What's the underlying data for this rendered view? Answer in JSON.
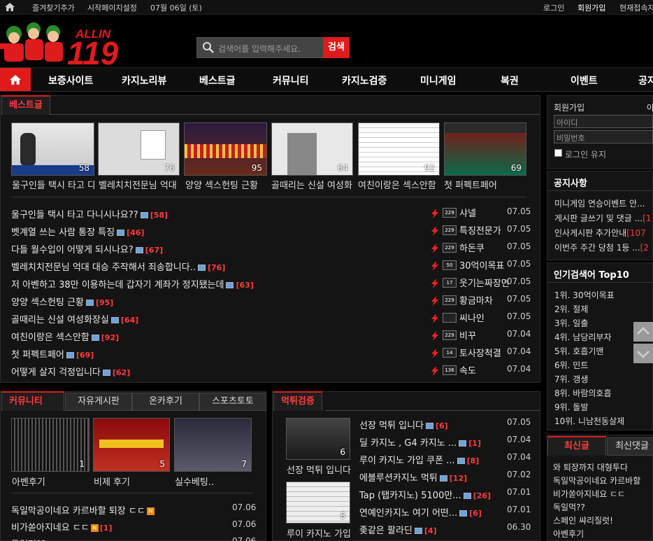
{
  "topbar": {
    "bookmark": "즐겨찾기추가",
    "start_page": "시작페이지설정",
    "date": "07월 06일 (토)",
    "login": "로그인",
    "join": "회원가입",
    "online": "현재접속자"
  },
  "logo": {
    "text": "ALLIN",
    "num": "119"
  },
  "search": {
    "placeholder": "검색어를 입력해주세요.",
    "button": "검색"
  },
  "nav": {
    "items": [
      "보증사이트",
      "카지노리뷰",
      "베스트글",
      "커뮤니티",
      "카지노검증",
      "미니게임",
      "복권",
      "이벤트",
      "공지"
    ]
  },
  "best": {
    "tab": "베스트글",
    "thumbs": [
      {
        "cap": "울구인들 택시 타고 다",
        "num": "58"
      },
      {
        "cap": "벨레치치전문님 억대",
        "num": "76"
      },
      {
        "cap": "양양 섹스헌팅 근황",
        "num": "95"
      },
      {
        "cap": "골때리는 신설 여성화",
        "num": "64"
      },
      {
        "cap": "여친이랑은 섹스안함",
        "num": "92"
      },
      {
        "cap": "첫 퍼펙트페어",
        "num": "69"
      }
    ],
    "rows": [
      {
        "title": "울구인들 택시 타고 다니시나요??",
        "count": "[58]",
        "nick": "샤넬",
        "date": "07.05",
        "lvl": "229"
      },
      {
        "title": "벳계열 쓰는 사람 통장 특징",
        "count": "[46]",
        "nick": "특징전문가",
        "date": "07.05",
        "lvl": "229"
      },
      {
        "title": "다들 월수입이 어떻게 되시나요?",
        "count": "[67]",
        "nick": "하돈쿠",
        "date": "07.05",
        "lvl": "229"
      },
      {
        "title": "벨레치치전문님 억대 대승 주작해서 죄송합니다..",
        "count": "[76]",
        "nick": "30억이목표",
        "date": "07.05",
        "lvl": "50"
      },
      {
        "title": "저 아벤하고 38만 이용하는데 갑자기 계좌가 정지됐는데",
        "count": "[63]",
        "nick": "웃기는짜장면",
        "date": "07.05",
        "lvl": "17"
      },
      {
        "title": "양양 섹스헌팅 근황",
        "count": "[95]",
        "nick": "황금마차",
        "date": "07.05",
        "lvl": "229"
      },
      {
        "title": "골때리는 신설 여성화장실",
        "count": "[64]",
        "nick": "씨나인",
        "date": "07.05",
        "lvl": ""
      },
      {
        "title": "여친이랑은 섹스안함",
        "count": "[92]",
        "nick": "비꾸",
        "date": "07.04",
        "lvl": "229"
      },
      {
        "title": "첫 퍼펙트페어",
        "count": "[69]",
        "nick": "토사장척결",
        "date": "07.04",
        "lvl": "14"
      },
      {
        "title": "어떻게 살지 걱정입니다",
        "count": "[62]",
        "nick": "속도",
        "date": "07.04",
        "lvl": "136"
      }
    ]
  },
  "community": {
    "tabs": [
      "커뮤니티",
      "자유게시판",
      "온카후기",
      "스포츠토토"
    ],
    "thumbs": [
      {
        "cap": "아벤후기",
        "num": "1"
      },
      {
        "cap": "비제 후기",
        "num": "5"
      },
      {
        "cap": "실수베팅..",
        "num": "7"
      }
    ],
    "rows": [
      {
        "title": "독일막공이네요 카르바할 퇴장 ㄷㄷ",
        "count": "",
        "date": "07.06"
      },
      {
        "title": "비가쏟아지네요 ㄷㄷ",
        "count": "[1]",
        "date": "07.06"
      },
      {
        "title": "독일먹??",
        "count": "",
        "date": "07.06"
      }
    ]
  },
  "verify": {
    "tab": "먹튀검증",
    "thumbs": [
      {
        "cap": "선장 먹튀 입니다",
        "num": "6"
      },
      {
        "cap": "루이 카지노 가입",
        "num": "8"
      }
    ],
    "rows": [
      {
        "title": "선장 먹튀 입니다",
        "count": "[6]",
        "date": "07.05"
      },
      {
        "title": "딜 카지노 , G4 카지노 ...",
        "count": "[1]",
        "date": "07.04"
      },
      {
        "title": "루이 카지노 가입 쿠폰 ...",
        "count": "[8]",
        "date": "07.04"
      },
      {
        "title": "에블루션카지노 먹튀",
        "count": "[12]",
        "date": "07.02"
      },
      {
        "title": "Tap (탭카지노) 5100만...",
        "count": "[26]",
        "date": "07.01"
      },
      {
        "title": "연예인카지노 여기 어떤...",
        "count": "[6]",
        "date": "07.01"
      },
      {
        "title": "좆같은 팔라딘",
        "count": "[4]",
        "date": "06.30"
      }
    ]
  },
  "login": {
    "join": "회원가입",
    "find": "아",
    "id_ph": "아이디",
    "pw_ph": "비밀번호",
    "keep": "로그인 유지"
  },
  "notice": {
    "title": "공지사항",
    "items": [
      {
        "t": "미니게임 연승이벤트 안...",
        "c": ""
      },
      {
        "t": "게시판 글쓰기 및 댓글 ...",
        "c": "[1"
      },
      {
        "t": "인사게시판 추가안내",
        "c": "[107"
      },
      {
        "t": "이번주 주간 당첨 1등 ...",
        "c": "[2"
      }
    ]
  },
  "popular": {
    "title": "인기검색어 Top10",
    "items": [
      "1위. 30억이목표",
      "2위. 절제",
      "3위. 일출",
      "4위. 남당리부자",
      "5위. 호흡기맨",
      "6위. 민트",
      "7위. 갱생",
      "8위. 바람의호흡",
      "9위. 돌발",
      "10위. 니남천동살제"
    ]
  },
  "latest": {
    "tabs": [
      "최신글",
      "최신댓글"
    ],
    "items": [
      "와 퇴장까지 대형투다",
      "독일막공이네요 카르바할",
      "비가쏟아지네요 ㄷㄷ",
      "독일먹??",
      "스페인 쌰리질럿!",
      "아벤후기"
    ]
  },
  "colors": {
    "accent": "#e01b1b",
    "bg": "#000000",
    "panel": "#141414"
  }
}
